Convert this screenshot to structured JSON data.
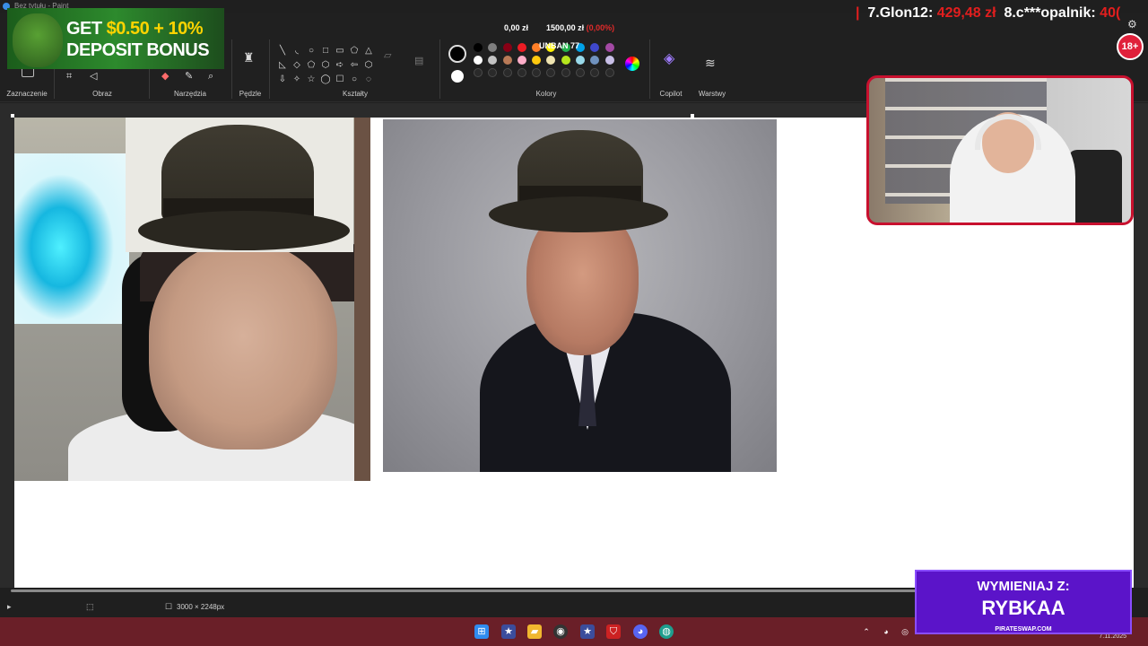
{
  "window": {
    "title": "Bez tytułu - Paint"
  },
  "ribbon": {
    "groups": {
      "selection": "Zaznaczenie",
      "image": "Obraz",
      "tools": "Narzędzia",
      "brushes": "Pędzle",
      "shapes": "Kształty",
      "colors": "Kolory",
      "copilot": "Copilot",
      "layers": "Warstwy"
    },
    "shape_glyphs": [
      "╲",
      "◟",
      "○",
      "□",
      "▭",
      "⬠",
      "△",
      "◺",
      "◇",
      "⬠",
      "⬡",
      "➪",
      "⇦",
      "⬡",
      "⇩",
      "✧",
      "☆",
      "◯",
      "☐",
      "○",
      "◌"
    ],
    "current_color": "#000000",
    "secondary_color": "#ffffff",
    "palette": [
      "#000000",
      "#7f7f7f",
      "#880015",
      "#ed1c24",
      "#ff7f27",
      "#fff200",
      "#22b14c",
      "#00a2e8",
      "#3f48cc",
      "#a349a4",
      "#ffffff",
      "#c3c3c3",
      "#b97a57",
      "#ffaec9",
      "#ffc90e",
      "#efe4b0",
      "#b5e61d",
      "#99d9ea",
      "#7092be",
      "#c8bfe7",
      "#2a2a2a",
      "#2a2a2a",
      "#2a2a2a",
      "#2a2a2a",
      "#2a2a2a",
      "#2a2a2a",
      "#2a2a2a",
      "#2a2a2a",
      "#2a2a2a",
      "#2a2a2a"
    ]
  },
  "status": {
    "canvas_size": "3000 × 2248px"
  },
  "overlays": {
    "ad": {
      "line1_a": "GET ",
      "line1_b": "$0.50 + 10%",
      "line2": "DEPOSIT BONUS"
    },
    "donation_bar": {
      "current": "0,00 zł",
      "goal": "1500,00 zł",
      "percent": "(0,00%)"
    },
    "unban": "UNBAN 77",
    "ticker": [
      {
        "rank": "7.Glon12:",
        "amount": "429,48 zł"
      },
      {
        "rank": "8.c***opalnik:",
        "amount": "40("
      }
    ],
    "age_badge": "18+",
    "promo": {
      "line1": "WYMIENIAJ Z:",
      "line2": "RYBKAA",
      "site": "PIRATESWAP.COM"
    }
  },
  "taskbar": {
    "date": "7.11.2025"
  }
}
